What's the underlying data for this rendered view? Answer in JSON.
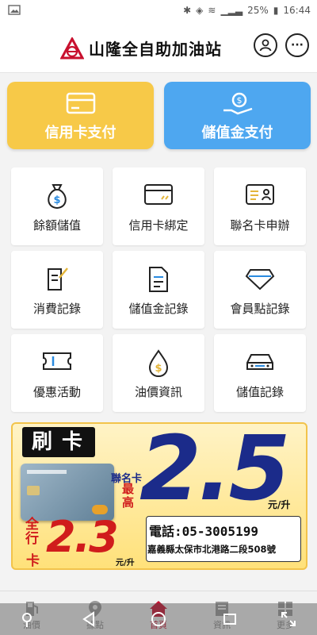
{
  "status": {
    "battery": "25%",
    "time": "16:44"
  },
  "header": {
    "title": "山隆全自助加油站"
  },
  "pay_buttons": [
    {
      "label": "信用卡支付",
      "color": "#F7C948"
    },
    {
      "label": "儲值金支付",
      "color": "#4EA7F0"
    }
  ],
  "grid": [
    {
      "label": "餘額儲值",
      "icon": "money-bag-icon"
    },
    {
      "label": "信用卡綁定",
      "icon": "credit-card-icon"
    },
    {
      "label": "聯名卡申辦",
      "icon": "id-card-icon"
    },
    {
      "label": "消費記錄",
      "icon": "receipt-edit-icon"
    },
    {
      "label": "儲值金記錄",
      "icon": "document-icon"
    },
    {
      "label": "會員點記錄",
      "icon": "diamond-icon"
    },
    {
      "label": "優惠活動",
      "icon": "ticket-icon"
    },
    {
      "label": "油價資訊",
      "icon": "oil-drop-icon"
    },
    {
      "label": "儲值記錄",
      "icon": "car-icon"
    }
  ],
  "banner": {
    "headline": "刷卡",
    "cobrand_label": "聯名卡",
    "highest_label": "最高",
    "big_price": "2.5",
    "big_unit": "元/升",
    "all_line_label_1": "全行",
    "all_line_label_2": "卡",
    "small_price": "2.3",
    "small_unit": "元/升",
    "phone": "電話:05-3005199",
    "address": "嘉義縣太保市北港路二段508號"
  },
  "nav": [
    {
      "label": "油價"
    },
    {
      "label": "據點"
    },
    {
      "label": "首頁"
    },
    {
      "label": "資訊"
    },
    {
      "label": "更多"
    }
  ],
  "colors": {
    "accent": "#C8102E",
    "yellow": "#F7C948",
    "blue": "#4EA7F0"
  }
}
